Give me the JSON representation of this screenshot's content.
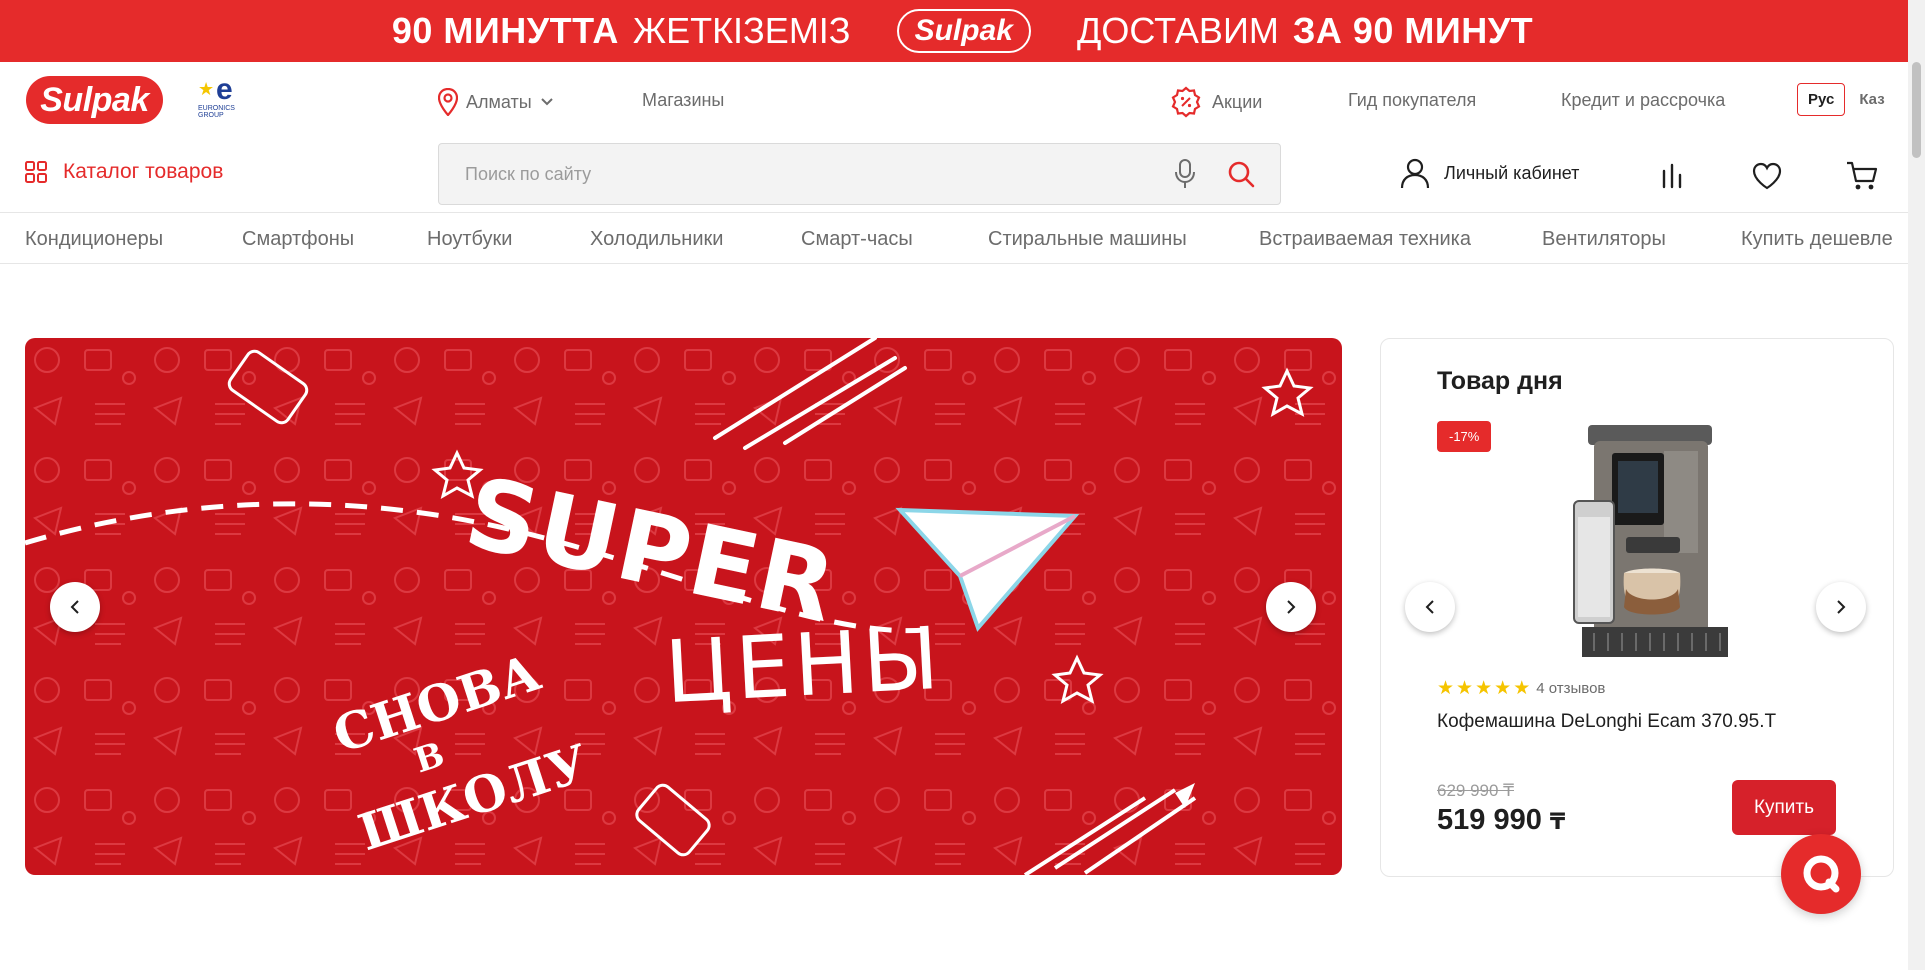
{
  "promo": {
    "part1": "90 МИНУТТА",
    "part2": "ЖЕТКІЗЕМІЗ",
    "logo": "Sulpak",
    "part3": "ДОСТАВИМ",
    "part4": "ЗА 90 МИНУТ"
  },
  "header": {
    "brand": "Sulpak",
    "partner_logo_text": "EURONICS GROUP",
    "city": "Алматы",
    "stores": "Магазины",
    "promotions": "Акции",
    "guide": "Гид покупателя",
    "credit": "Кредит и рассрочка",
    "lang_active": "Рус",
    "lang_other": "Каз"
  },
  "toolbar": {
    "catalog": "Каталог товаров",
    "search_placeholder": "Поиск по сайту",
    "account": "Личный кабинет"
  },
  "categories": [
    "Кондиционеры",
    "Смартфоны",
    "Ноутбуки",
    "Холодильники",
    "Смарт-часы",
    "Стиральные машины",
    "Встраиваемая техника",
    "Вентиляторы",
    "Купить дешевле"
  ],
  "hero": {
    "line1": "SUPER",
    "line2": "ЦЕНЫ",
    "line3": "СНОВА",
    "line4": "В",
    "line5": "ШКОЛУ"
  },
  "deal": {
    "title": "Товар дня",
    "badge": "-17%",
    "rating": 5,
    "reviews": "4 отзывов",
    "name": "Кофемашина DeLonghi Ecam 370.95.T",
    "old_price": "629 990 ₸",
    "price": "519 990",
    "currency": "₸",
    "buy": "Купить"
  },
  "colors": {
    "brand_red": "#e52b2b",
    "hero_red": "#c8141c",
    "star": "#f5c400"
  }
}
